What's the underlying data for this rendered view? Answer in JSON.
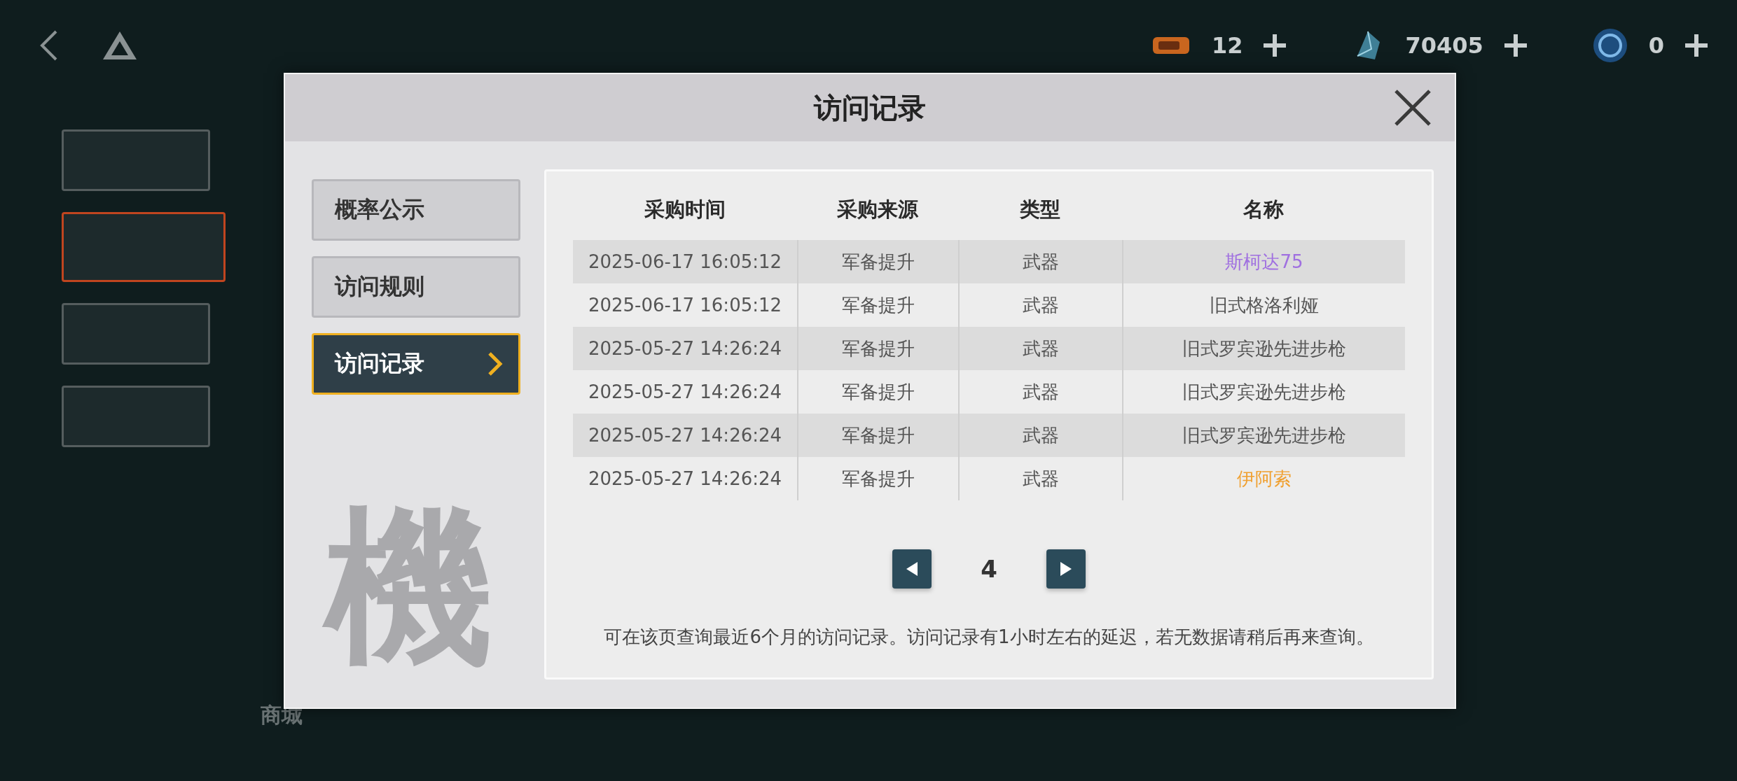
{
  "top_bar": {
    "currencies": [
      {
        "kind": "ticket",
        "amount": "12"
      },
      {
        "kind": "crystal",
        "amount": "70405"
      },
      {
        "kind": "coin",
        "amount": "0"
      }
    ]
  },
  "side_cards": [
    {
      "selected": false
    },
    {
      "selected": true
    },
    {
      "selected": false
    },
    {
      "selected": false
    }
  ],
  "bottom_nav": {
    "label": "商城"
  },
  "dialog": {
    "title": "访问记录",
    "side_tabs": [
      {
        "label": "概率公示",
        "selected": false
      },
      {
        "label": "访问规则",
        "selected": false
      },
      {
        "label": "访问记录",
        "selected": true
      }
    ],
    "backdrop_glyph": "機",
    "table": {
      "columns": [
        "采购时间",
        "采购来源",
        "类型",
        "名称"
      ],
      "rows": [
        {
          "time": "2025-06-17 16:05:12",
          "source": "军备提升",
          "type": "武器",
          "name": "斯柯达75",
          "color": "#a070e0"
        },
        {
          "time": "2025-06-17 16:05:12",
          "source": "军备提升",
          "type": "武器",
          "name": "旧式格洛利娅",
          "color": "#555555"
        },
        {
          "time": "2025-05-27 14:26:24",
          "source": "军备提升",
          "type": "武器",
          "name": "旧式罗宾逊先进步枪",
          "color": "#555555"
        },
        {
          "time": "2025-05-27 14:26:24",
          "source": "军备提升",
          "type": "武器",
          "name": "旧式罗宾逊先进步枪",
          "color": "#555555"
        },
        {
          "time": "2025-05-27 14:26:24",
          "source": "军备提升",
          "type": "武器",
          "name": "旧式罗宾逊先进步枪",
          "color": "#555555"
        },
        {
          "time": "2025-05-27 14:26:24",
          "source": "军备提升",
          "type": "武器",
          "name": "伊阿索",
          "color": "#f0a030"
        }
      ]
    },
    "page": "4",
    "note": "可在该页查询最近6个月的访问记录。访问记录有1小时左右的延迟，若无数据请稍后再来查询。"
  }
}
